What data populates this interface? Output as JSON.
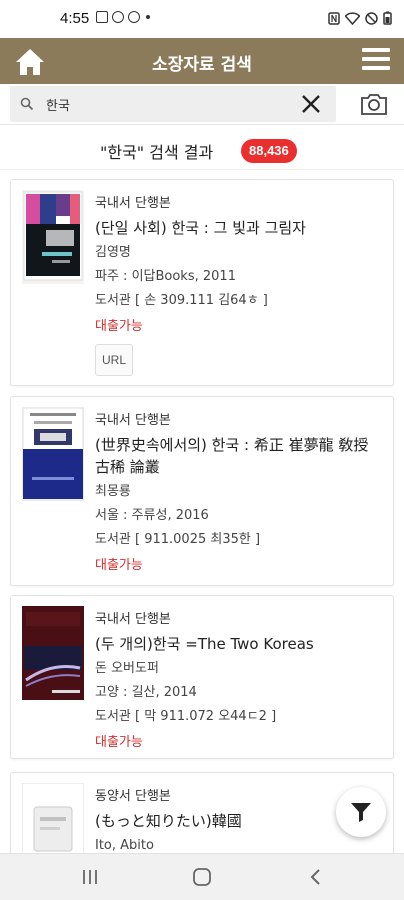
{
  "status_bar": {
    "time": "4:55"
  },
  "header": {
    "title": "소장자료 검색"
  },
  "search": {
    "query": "한국"
  },
  "results": {
    "label": "\"한국\" 검색 결과",
    "count": "88,436"
  },
  "books": [
    {
      "type": "국내서 단행본",
      "title": "(단일 사회) 한국 : 그 빛과 그림자",
      "author": "김영명",
      "publisher": "파주 : 이답Books, 2011",
      "callno": "도서관 [ 손 309.111 김64ㅎ ]",
      "status": "대출가능",
      "url_label": "URL"
    },
    {
      "type": "국내서 단행본",
      "title": "(世界史속에서의) 한국 : 希正 崔夢龍 敎授 古稀 論叢",
      "author": "최몽룡",
      "publisher": "서울 : 주류성, 2016",
      "callno": "도서관 [ 911.0025 최35한 ]",
      "status": "대출가능"
    },
    {
      "type": "국내서 단행본",
      "title": "(두 개의)한국 =The Two Koreas",
      "author": "돈 오버도퍼",
      "publisher": "고양 : 길산, 2014",
      "callno": "도서관 [ 막 911.072 오44ㄷ2 ]",
      "status": "대출가능"
    },
    {
      "type": "동양서 단행본",
      "title": "(もっと知りたい)韓國",
      "author": "Ito, Abito"
    }
  ]
}
